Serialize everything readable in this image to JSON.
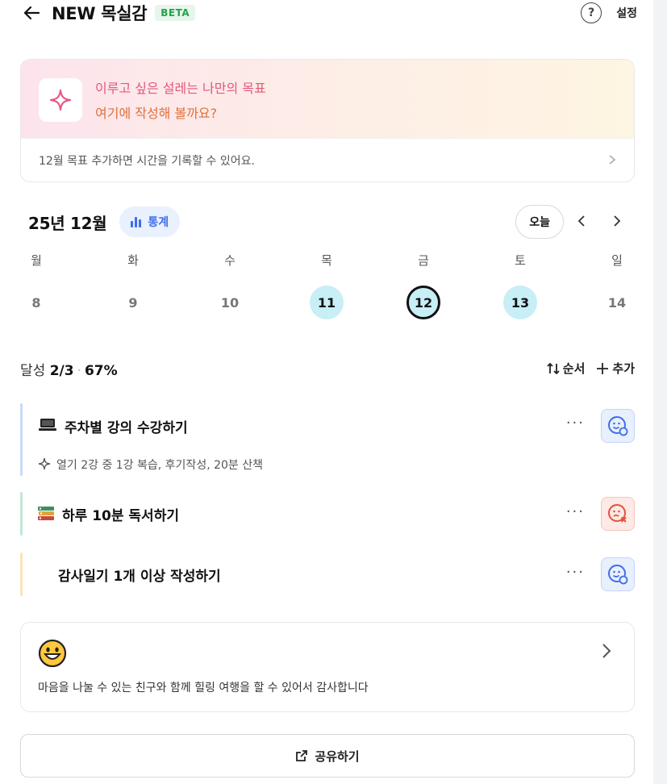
{
  "header": {
    "title": "NEW 목실감",
    "badge": "BETA",
    "settings_label": "설정",
    "help_symbol": "?"
  },
  "goal_card": {
    "line1": "이루고 싶은 설레는 나만의 목표",
    "line2": "여기에 작성해 볼까요?",
    "hint": "12월 목표  추가하면 시간을 기록할 수 있어요."
  },
  "calendar": {
    "month_title": "25년 12월",
    "stats_label": "통계",
    "today_label": "오늘",
    "days": [
      {
        "label": "월",
        "date": "8",
        "state": "none"
      },
      {
        "label": "화",
        "date": "9",
        "state": "none"
      },
      {
        "label": "수",
        "date": "10",
        "state": "none"
      },
      {
        "label": "목",
        "date": "11",
        "state": "done"
      },
      {
        "label": "금",
        "date": "12",
        "state": "selected"
      },
      {
        "label": "토",
        "date": "13",
        "state": "done"
      },
      {
        "label": "일",
        "date": "14",
        "state": "none"
      }
    ]
  },
  "summary": {
    "prefix": "달성",
    "count": "2/3",
    "percent": "67%",
    "order_label": "순서",
    "add_label": "추가"
  },
  "todos": [
    {
      "text": "주차별 강의 수강하기",
      "sub": "열기 2강 중 1강 복습, 후기작성, 20분 산책",
      "status": "done",
      "color": "#c9d8fb"
    },
    {
      "text": "하루 10분 독서하기",
      "status": "failed",
      "color": "#bfe9d3"
    },
    {
      "text": "감사일기 1개 이상 작성하기",
      "status": "done",
      "color": "#fbe3b8"
    }
  ],
  "gratitude": {
    "text": "마음을 나눌 수 있는 친구와 함께 힐링 여행을 할 수 있어서 감사합니다"
  },
  "share": {
    "label": "공유하기"
  },
  "colors": {
    "accent_blue": "#3f6fe6",
    "beta_green": "#23a24d",
    "pink": "#e15a7a",
    "orange": "#e0703a"
  }
}
